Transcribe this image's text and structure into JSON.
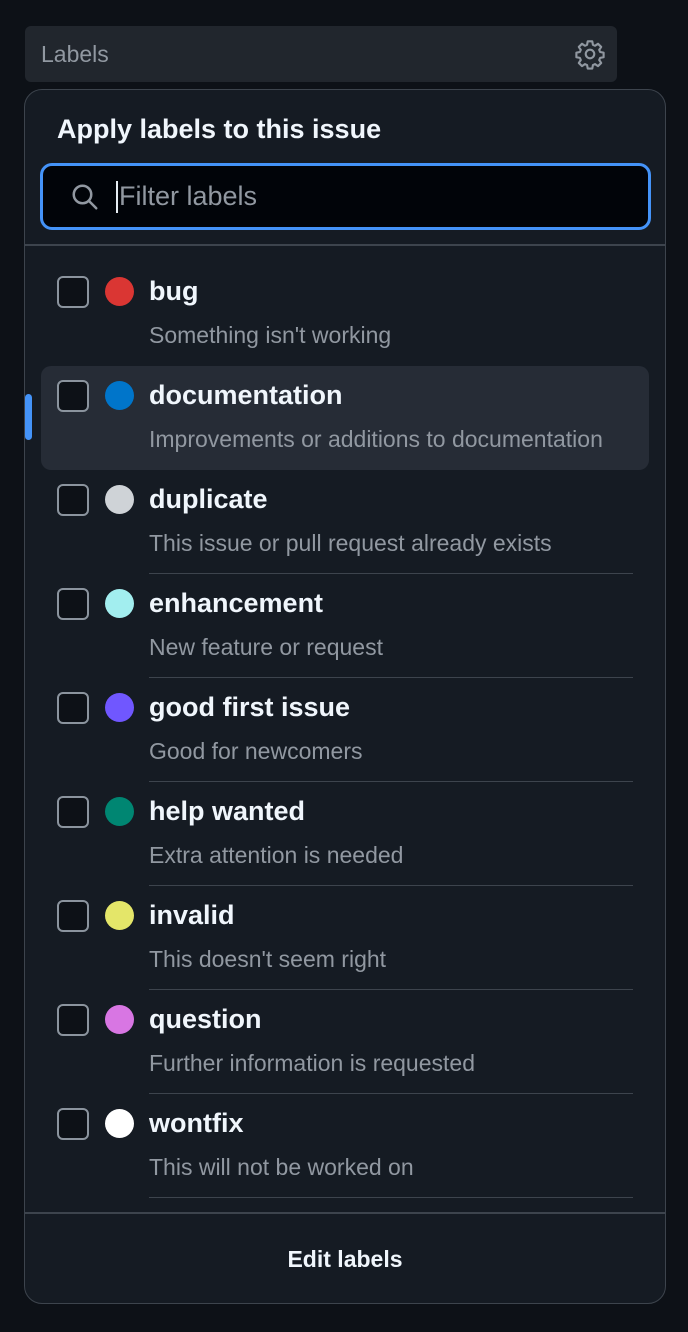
{
  "header": {
    "label": "Labels",
    "settings_icon": "gear-icon"
  },
  "panel": {
    "title": "Apply labels to this issue",
    "filter": {
      "placeholder": "Filter labels",
      "value": "",
      "icon": "search-icon"
    },
    "labels": [
      {
        "name": "bug",
        "description": "Something isn't working",
        "color": "#da3633",
        "checked": false
      },
      {
        "name": "documentation",
        "description": "Improvements or additions to documentation",
        "color": "#0075ca",
        "checked": false
      },
      {
        "name": "duplicate",
        "description": "This issue or pull request already exists",
        "color": "#cfd3d7",
        "checked": false
      },
      {
        "name": "enhancement",
        "description": "New feature or request",
        "color": "#a2eeef",
        "checked": false
      },
      {
        "name": "good first issue",
        "description": "Good for newcomers",
        "color": "#7057ff",
        "checked": false
      },
      {
        "name": "help wanted",
        "description": "Extra attention is needed",
        "color": "#008672",
        "checked": false
      },
      {
        "name": "invalid",
        "description": "This doesn't seem right",
        "color": "#e4e669",
        "checked": false
      },
      {
        "name": "question",
        "description": "Further information is requested",
        "color": "#d876e3",
        "checked": false
      },
      {
        "name": "wontfix",
        "description": "This will not be worked on",
        "color": "#ffffff",
        "checked": false
      }
    ],
    "edit_label": "Edit labels"
  },
  "colors": {
    "accent": "#4493f8",
    "background": "#0d1117",
    "panel": "#151b23"
  }
}
